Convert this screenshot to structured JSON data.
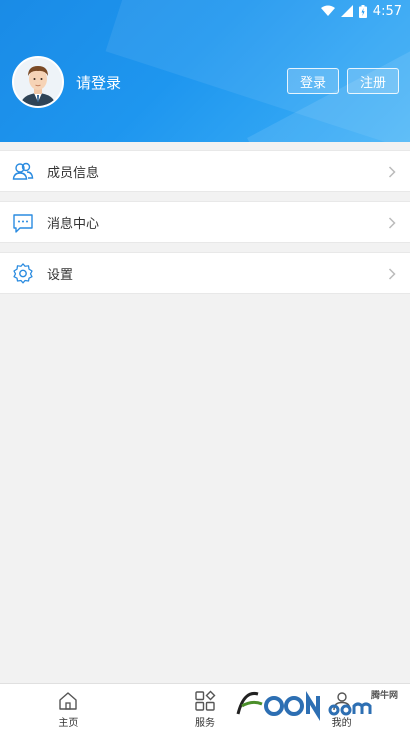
{
  "status_bar": {
    "time": "4:57"
  },
  "profile": {
    "login_prompt": "请登录",
    "login_button": "登录",
    "register_button": "注册"
  },
  "menu": [
    {
      "label": "成员信息",
      "icon": "members-icon"
    },
    {
      "label": "消息中心",
      "icon": "message-icon"
    },
    {
      "label": "设置",
      "icon": "gear-icon"
    }
  ],
  "bottom_nav": [
    {
      "label": "主页",
      "icon": "home-icon"
    },
    {
      "label": "服务",
      "icon": "grid-icon"
    },
    {
      "label": "我的",
      "icon": "person-icon"
    }
  ],
  "watermark": {
    "text": "腾牛网"
  },
  "colors": {
    "header_blue": "#1e96ef",
    "icon_blue": "#2a8be0"
  }
}
